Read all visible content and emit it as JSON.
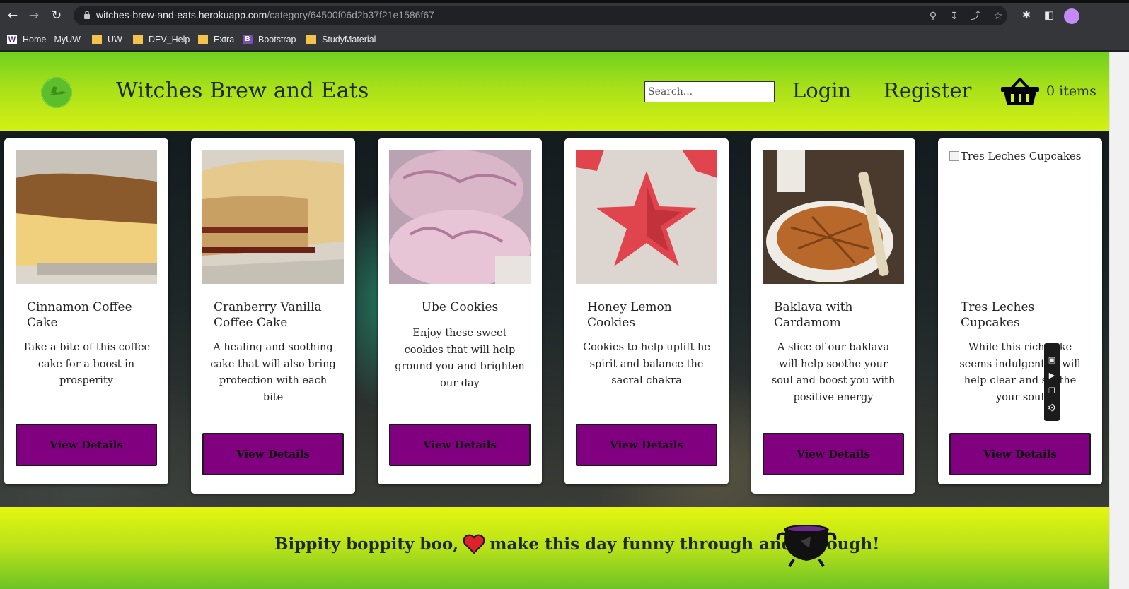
{
  "browser": {
    "url_host": "witches-brew-and-eats.herokuapp.com",
    "url_path": "/category/64500f06d2b37f21e1586f67",
    "bookmarks": [
      {
        "label": "Home - MyUW",
        "icon": "uw-w-icon"
      },
      {
        "label": "UW",
        "icon": "folder-icon"
      },
      {
        "label": "DEV_Help",
        "icon": "folder-icon"
      },
      {
        "label": "Extra",
        "icon": "folder-icon"
      },
      {
        "label": "Bootstrap",
        "icon": "bootstrap-icon"
      },
      {
        "label": "StudyMaterial",
        "icon": "folder-icon"
      }
    ]
  },
  "header": {
    "title": "Witches Brew and Eats",
    "search_placeholder": "Search...",
    "login": "Login",
    "register": "Register",
    "cart_label": "0 items"
  },
  "products": [
    {
      "title": "Cinnamon Coffee Cake",
      "description": "Take a bite of this coffee cake for a boost in prosperity",
      "button": "View Details"
    },
    {
      "title": "Cranberry Vanilla Coffee Cake",
      "description": "A healing and soothing cake that will also bring protection with each bite",
      "button": "View Details"
    },
    {
      "title": "Ube Cookies",
      "description": "Enjoy these sweet cookies that will help ground you and brighten our day",
      "button": "View Details"
    },
    {
      "title": "Honey Lemon Cookies",
      "description": "Cookies to help uplift he spirit and balance the sacral chakra",
      "button": "View Details"
    },
    {
      "title": "Baklava with Cardamom",
      "description": "A slice of our baklava will help soothe your soul and boost you with positive energy",
      "button": "View Details"
    },
    {
      "title": "Tres Leches Cupcakes",
      "image_alt": "Tres Leches Cupcakes",
      "description": "While this rich cake seems indulgent, it will help clear and soothe your soul",
      "button": "View Details"
    }
  ],
  "footer": {
    "tagline_start": "Bippity boppity boo,",
    "tagline_end": "make this day funny through and through!"
  },
  "colors": {
    "button": "#800080",
    "header_green": "#a8e01a",
    "footer_yellow": "#e4f60f"
  }
}
